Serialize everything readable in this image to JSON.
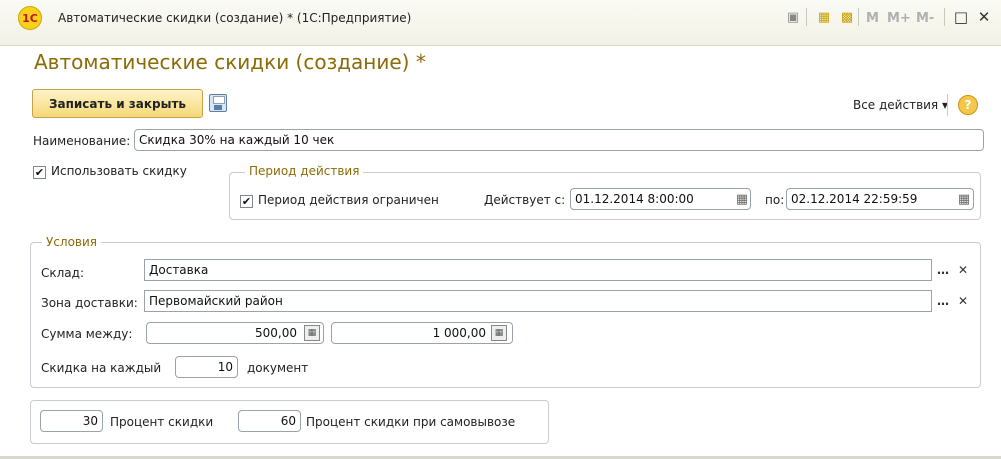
{
  "window": {
    "logo_text": "1C",
    "title": "Автоматические скидки (создание) * (1С:Предприятие)",
    "m_buttons": [
      "M",
      "M+",
      "M-"
    ]
  },
  "form": {
    "title": "Автоматические скидки (создание) *",
    "save_close_label": "Записать и закрыть",
    "all_actions_label": "Все действия ▾",
    "help_label": "?"
  },
  "fields": {
    "name_label": "Наименование:",
    "name_value": "Скидка 30% на каждый 10 чек",
    "use_discount_label": "Использовать скидку",
    "use_discount_checked": true
  },
  "period": {
    "title": "Период действия",
    "limited_label": "Период действия ограничен",
    "limited_checked": true,
    "from_label": "Действует с:",
    "from_value": "01.12.2014  8:00:00",
    "to_label": "по:",
    "to_value": "02.12.2014 22:59:59"
  },
  "conditions": {
    "title": "Условия",
    "warehouse_label": "Склад:",
    "warehouse_value": "Доставка",
    "zone_label": "Зона доставки:",
    "zone_value": "Первомайский район",
    "sum_label": "Сумма между:",
    "sum_from": "500,00",
    "sum_to": "1 000,00",
    "each_label": "Скидка на каждый",
    "each_value": "10",
    "each_suffix": "документ"
  },
  "discount": {
    "percent_value": "30",
    "percent_label": "Процент скидки",
    "pickup_value": "60",
    "pickup_label": "Процент скидки при самовывозе"
  },
  "colors": {
    "title_accent": "#8a6b06",
    "primary_button": "#f4d877"
  }
}
